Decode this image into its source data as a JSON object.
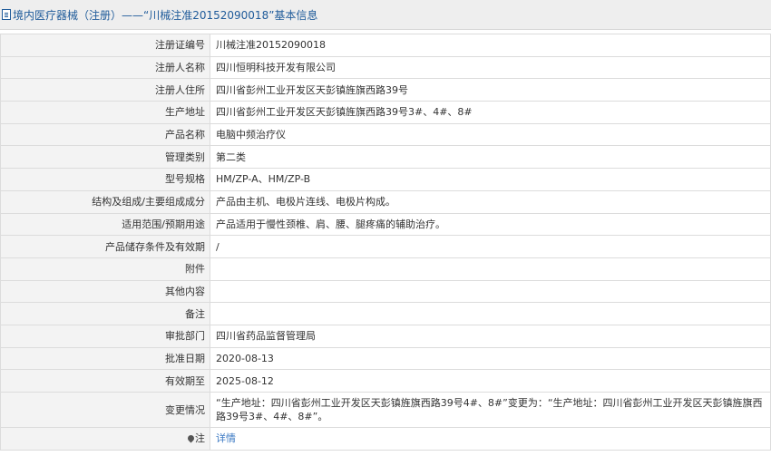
{
  "header": {
    "title": "境内医疗器械（注册）——“川械注准20152090018”基本信息"
  },
  "rows": [
    {
      "label": "注册证编号",
      "value": "川械注准20152090018"
    },
    {
      "label": "注册人名称",
      "value": "四川恒明科技开发有限公司"
    },
    {
      "label": "注册人住所",
      "value": "四川省彭州工业开发区天彭镇旌旗西路39号"
    },
    {
      "label": "生产地址",
      "value": "四川省彭州工业开发区天彭镇旌旗西路39号3#、4#、8#"
    },
    {
      "label": "产品名称",
      "value": "电脑中频治疗仪"
    },
    {
      "label": "管理类别",
      "value": "第二类"
    },
    {
      "label": "型号规格",
      "value": "HM/ZP-A、HM/ZP-B"
    },
    {
      "label": "结构及组成/主要组成成分",
      "value": "产品由主机、电极片连线、电极片构成。"
    },
    {
      "label": "适用范围/预期用途",
      "value": "产品适用于慢性颈椎、肩、腰、腿疼痛的辅助治疗。"
    },
    {
      "label": "产品储存条件及有效期",
      "value": "/"
    },
    {
      "label": "附件",
      "value": ""
    },
    {
      "label": "其他内容",
      "value": ""
    },
    {
      "label": "备注",
      "value": ""
    },
    {
      "label": "审批部门",
      "value": "四川省药品监督管理局"
    },
    {
      "label": "批准日期",
      "value": "2020-08-13"
    },
    {
      "label": "有效期至",
      "value": "2025-08-12"
    },
    {
      "label": "变更情况",
      "value": "“生产地址：四川省彭州工业开发区天彭镇旌旗西路39号4#、8#”变更为：“生产地址：四川省彭州工业开发区天彭镇旌旗西路39号3#、4#、8#”。"
    },
    {
      "label": "注",
      "value": "详情"
    }
  ]
}
